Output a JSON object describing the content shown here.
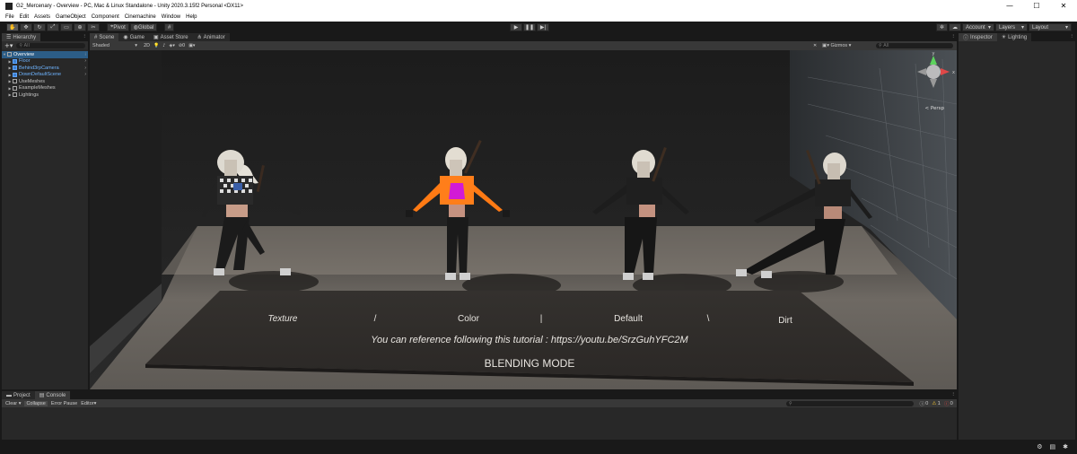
{
  "window": {
    "title": "G2_Mercenary - Overview - PC, Mac & Linux Standalone - Unity 2020.3.15f2 Personal <DX11>",
    "minimize": "—",
    "maximize": "☐",
    "close": "✕"
  },
  "menu": [
    "File",
    "Edit",
    "Assets",
    "GameObject",
    "Component",
    "Cinemachine",
    "Window",
    "Help"
  ],
  "toolbar": {
    "pivot": "Pivot",
    "global": "Global",
    "account": "Account",
    "layers": "Layers",
    "layout": "Layout"
  },
  "hierarchy": {
    "tab": "Hierarchy",
    "search_placeholder": "All",
    "items": [
      {
        "label": "Overview",
        "selected": true,
        "depth": 0
      },
      {
        "label": "Floor",
        "blue": true,
        "depth": 1
      },
      {
        "label": "Behind3rpCamera",
        "blue": true,
        "depth": 1
      },
      {
        "label": "DownDefaultScene",
        "blue": true,
        "depth": 1
      },
      {
        "label": "UseMeshes",
        "depth": 1
      },
      {
        "label": "ExampleMeshes",
        "depth": 1
      },
      {
        "label": "Lightings",
        "depth": 1
      }
    ]
  },
  "scene": {
    "tabs": [
      "Scene",
      "Game",
      "Asset Store",
      "Animator"
    ],
    "shading": "Shaded",
    "mode_2d": "2D",
    "gizmos": "Gizmos",
    "search_placeholder": "All",
    "persp": "< Persp",
    "axis_y": "y",
    "axis_x": "x",
    "labels": [
      "Texture",
      "/",
      "Color",
      "|",
      "Default",
      "\\",
      "Dirt"
    ],
    "tutorial": "You can reference following this tutorial : https://youtu.be/SrzGuhYFC2M",
    "blending": "BLENDING MODE"
  },
  "inspector": {
    "tabs": [
      "Inspector",
      "Lighting"
    ]
  },
  "console": {
    "tabs": [
      "Project",
      "Console"
    ],
    "clear": "Clear",
    "collapse": "Collapse",
    "error_pause": "Error Pause",
    "editor": "Editor",
    "count_log": "0",
    "count_warn": "1",
    "count_err": "0"
  }
}
